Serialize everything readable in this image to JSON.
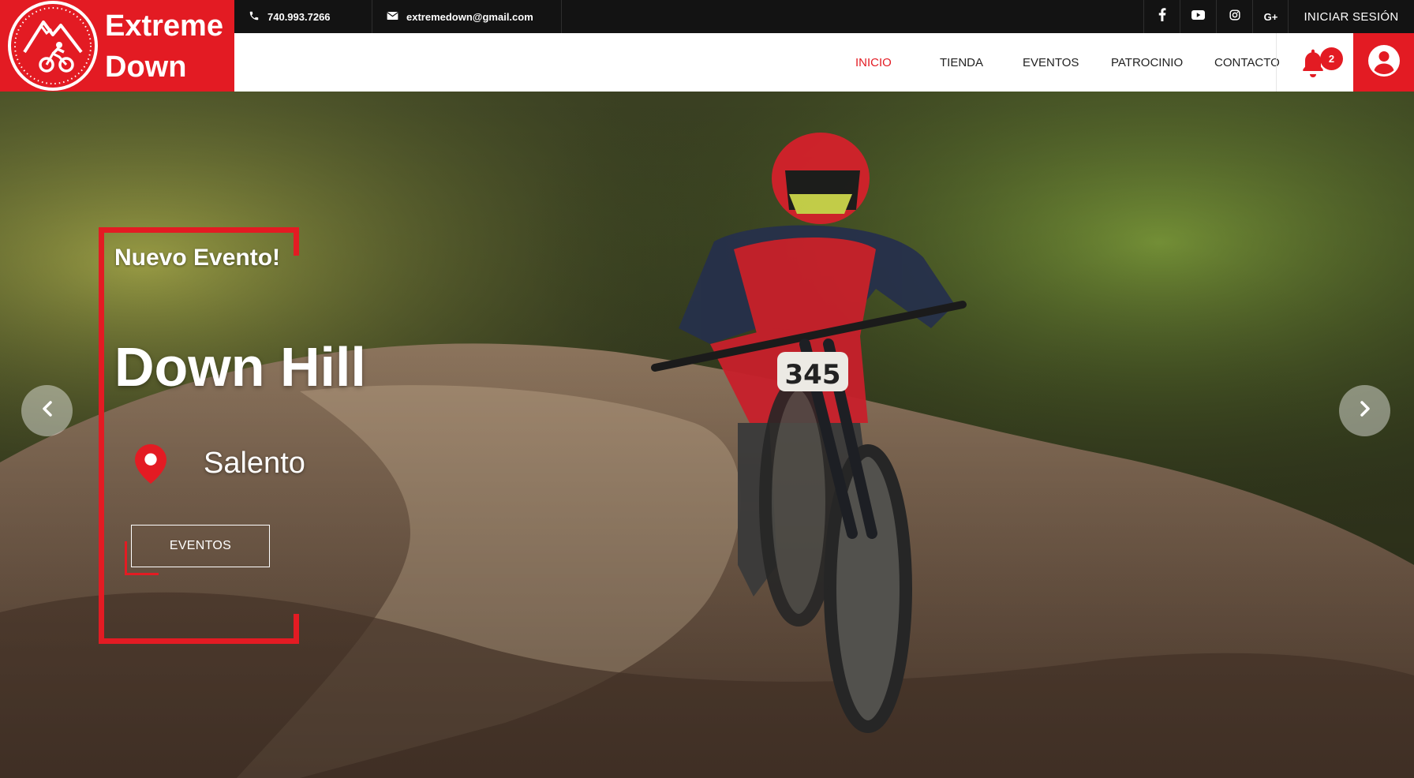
{
  "brand": {
    "line1": "Extreme",
    "line2": "Down",
    "color": "#e31b23"
  },
  "topbar": {
    "phone": "740.993.7266",
    "email": "extremedown@gmail.com",
    "social_icons": [
      "facebook-icon",
      "youtube-icon",
      "instagram-icon",
      "google-plus-icon"
    ],
    "google_plus": "G+",
    "login_label": "INICIAR SESIÓN"
  },
  "nav": {
    "items": [
      {
        "label": "INICIO",
        "active": true
      },
      {
        "label": "TIENDA",
        "active": false
      },
      {
        "label": "EVENTOS",
        "active": false
      },
      {
        "label": "PATROCINIO",
        "active": false
      },
      {
        "label": "CONTACTO",
        "active": false
      }
    ],
    "notifications_count": "2"
  },
  "hero": {
    "kicker": "Nuevo Evento!",
    "title": "Down Hill",
    "location": "Salento",
    "button_label": "EVENTOS"
  }
}
